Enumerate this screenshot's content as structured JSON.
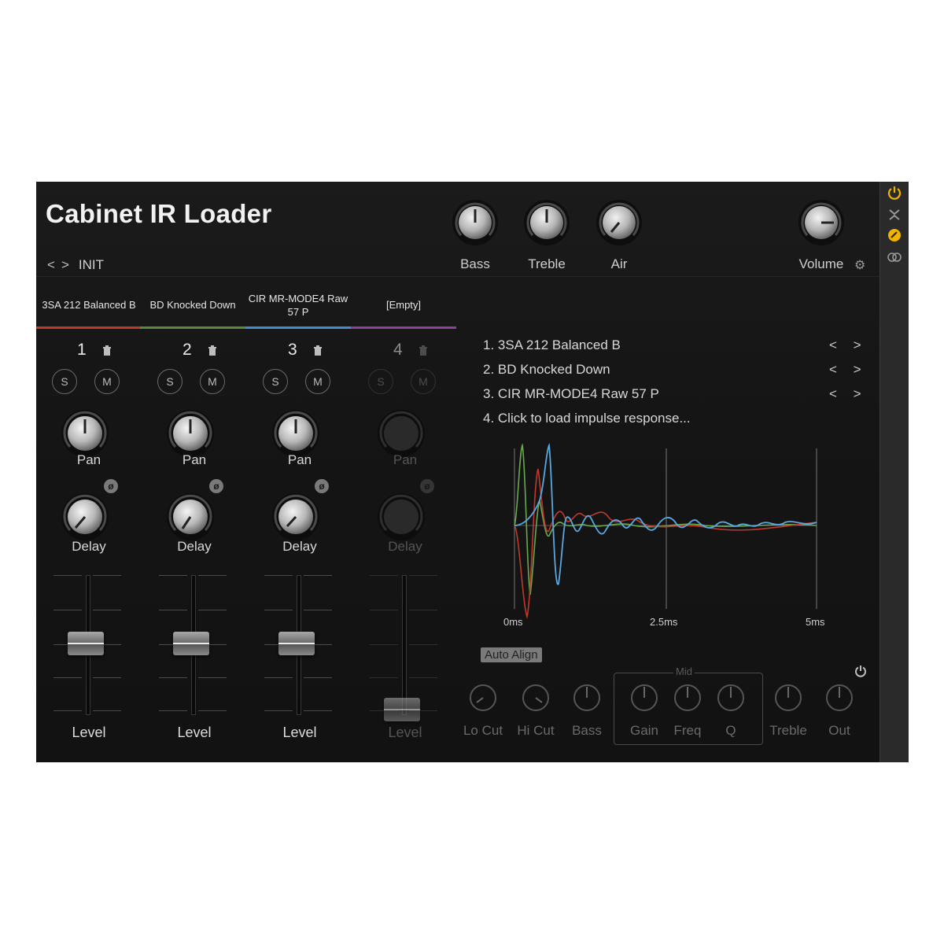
{
  "app": {
    "title": "Cabinet IR Loader"
  },
  "preset": {
    "prev": "<",
    "next": ">",
    "name": "INIT"
  },
  "top_knobs": [
    {
      "label": "Bass"
    },
    {
      "label": "Treble"
    },
    {
      "label": "Air"
    },
    {
      "label": "Volume"
    }
  ],
  "slots": [
    {
      "name": "3SA 212 Balanced B",
      "color": "#c0392b"
    },
    {
      "name": "BD Knocked Down",
      "color": "#5d8a3a"
    },
    {
      "name": "CIR MR-MODE4 Raw 57 P",
      "color": "#3e8ed0"
    },
    {
      "name": "[Empty]",
      "color": "#8e3fa0"
    }
  ],
  "channels": [
    {
      "number": "1",
      "solo": "S",
      "mute": "M",
      "pan_label": "Pan",
      "delay_label": "Delay",
      "level_label": "Level",
      "phase": "ø"
    },
    {
      "number": "2",
      "solo": "S",
      "mute": "M",
      "pan_label": "Pan",
      "delay_label": "Delay",
      "level_label": "Level",
      "phase": "ø"
    },
    {
      "number": "3",
      "solo": "S",
      "mute": "M",
      "pan_label": "Pan",
      "delay_label": "Delay",
      "level_label": "Level",
      "phase": "ø"
    },
    {
      "number": "4",
      "solo": "S",
      "mute": "M",
      "pan_label": "Pan",
      "delay_label": "Delay",
      "level_label": "Level",
      "phase": "ø"
    }
  ],
  "ir_list": [
    {
      "text": "1. 3SA 212 Balanced B",
      "arrows": "<>"
    },
    {
      "text": "2. BD Knocked Down",
      "arrows": "<>"
    },
    {
      "text": "3. CIR MR-MODE4 Raw 57 P",
      "arrows": "<>"
    },
    {
      "text": "4. Click to load impulse response...",
      "arrows": ""
    }
  ],
  "waveform": {
    "time_labels": [
      "0ms",
      "2.5ms",
      "5ms"
    ],
    "colors": {
      "green": "#6aa84f",
      "red": "#c0392b",
      "blue": "#5aa7e0"
    }
  },
  "auto_align": "Auto Align",
  "eq": {
    "mid_title": "Mid",
    "labels": [
      "Lo Cut",
      "Hi Cut",
      "Bass",
      "Gain",
      "Freq",
      "Q",
      "Treble",
      "Out"
    ]
  }
}
